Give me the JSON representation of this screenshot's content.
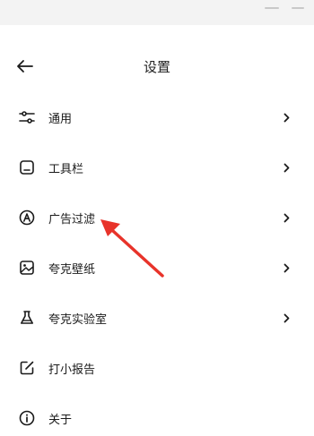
{
  "header": {
    "title": "设置",
    "back_icon": "arrow-left-icon"
  },
  "menu": [
    {
      "label": "通用",
      "icon": "sliders-icon",
      "has_chevron": true
    },
    {
      "label": "工具栏",
      "icon": "toolbar-icon",
      "has_chevron": true
    },
    {
      "label": "广告过滤",
      "icon": "ad-filter-icon",
      "has_chevron": true
    },
    {
      "label": "夸克壁纸",
      "icon": "wallpaper-icon",
      "has_chevron": true
    },
    {
      "label": "夸克实验室",
      "icon": "flask-icon",
      "has_chevron": true
    },
    {
      "label": "打小报告",
      "icon": "feedback-icon",
      "has_chevron": false
    },
    {
      "label": "关于",
      "icon": "info-icon",
      "has_chevron": false
    }
  ],
  "colors": {
    "annotation_arrow": "#e8332a",
    "text": "#1a1a1a",
    "topbar": "#f3f3f3"
  }
}
